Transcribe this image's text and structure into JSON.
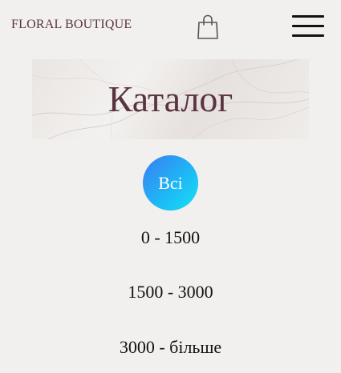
{
  "header": {
    "brand": "FLORAL BOUTIQUE",
    "cart_icon": "shopping-bag-icon",
    "menu_icon": "hamburger-menu-icon"
  },
  "hero": {
    "title": "Каталог"
  },
  "filters": {
    "all_label": "Всі",
    "ranges": [
      "0 - 1500",
      "1500 - 3000",
      "3000 - більше"
    ]
  },
  "colors": {
    "brand_text": "#5a3340",
    "background": "#f2f0ee",
    "active_filter_gradient_start": "#3a7cf0",
    "active_filter_gradient_end": "#14e3f2"
  }
}
